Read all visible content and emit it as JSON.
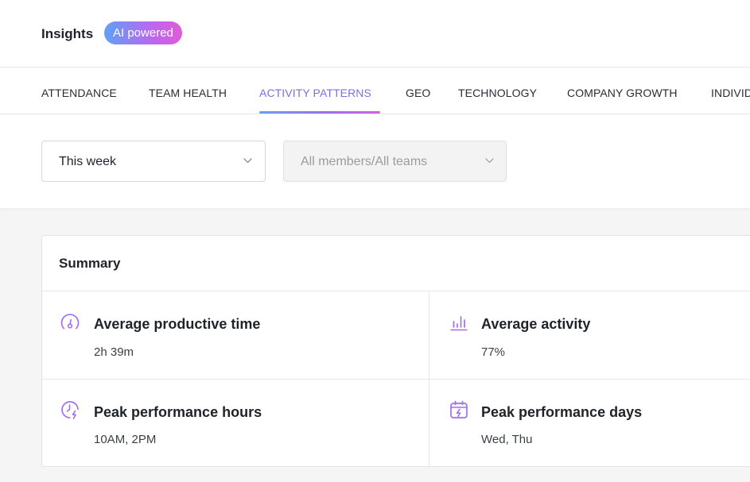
{
  "header": {
    "title": "Insights",
    "badge": "AI powered"
  },
  "tabs": [
    {
      "label": "ATTENDANCE",
      "active": false
    },
    {
      "label": "TEAM HEALTH",
      "active": false
    },
    {
      "label": "ACTIVITY PATTERNS",
      "active": true
    },
    {
      "label": "GEO",
      "active": false
    },
    {
      "label": "TECHNOLOGY",
      "active": false
    },
    {
      "label": "COMPANY GROWTH",
      "active": false
    },
    {
      "label": "INDIVIDUAL",
      "active": false
    }
  ],
  "filters": {
    "period": "This week",
    "members": "All members/All teams"
  },
  "summary": {
    "title": "Summary",
    "metrics": [
      {
        "label": "Average productive time",
        "value": "2h 39m",
        "icon": "gauge-icon"
      },
      {
        "label": "Average activity",
        "value": "77%",
        "icon": "bar-chart-icon"
      },
      {
        "label": "Peak performance hours",
        "value": "10AM, 2PM",
        "icon": "clock-bolt-icon"
      },
      {
        "label": "Peak performance days",
        "value": "Wed, Thu",
        "icon": "calendar-bolt-icon"
      }
    ]
  },
  "colors": {
    "accent": "#7b6ee8",
    "icon": "#a16ff0",
    "gradient_start": "#5fa1f6",
    "gradient_end": "#e05cd6"
  }
}
